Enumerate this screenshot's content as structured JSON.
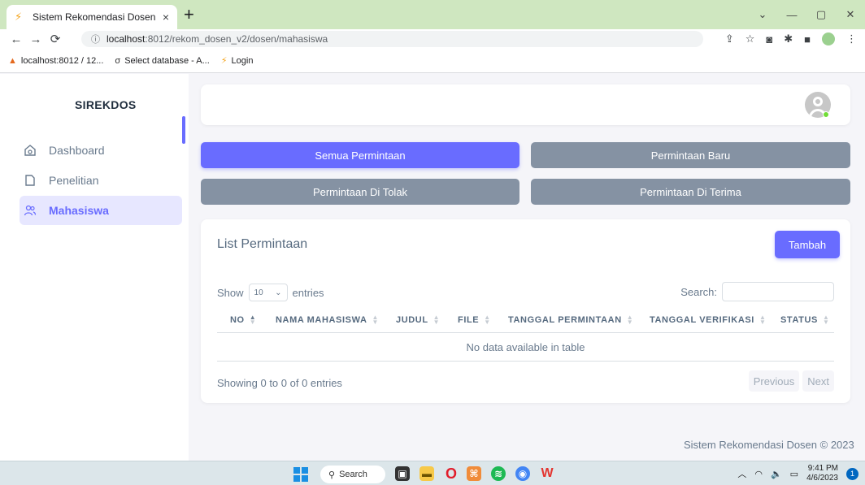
{
  "browser": {
    "tab_title": "Sistem Rekomendasi Dosen",
    "tab_close": "×",
    "new_tab": "+",
    "url_host": "localhost",
    "url_path": ":8012/rekom_dosen_v2/dosen/mahasiswa",
    "bookmarks": [
      {
        "label": "localhost:8012 / 12..."
      },
      {
        "label": "Select database - A..."
      },
      {
        "label": "Login"
      }
    ]
  },
  "sidebar": {
    "brand": "SIREKDOS",
    "items": [
      {
        "label": "Dashboard",
        "icon": "home-icon",
        "active": false
      },
      {
        "label": "Penelitian",
        "icon": "file-icon",
        "active": false
      },
      {
        "label": "Mahasiswa",
        "icon": "users-icon",
        "active": true
      }
    ]
  },
  "filters": {
    "all": "Semua Permintaan",
    "new": "Permintaan Baru",
    "rejected": "Permintaan Di Tolak",
    "accepted": "Permintaan Di Terima"
  },
  "list": {
    "title": "List Permintaan",
    "add_button": "Tambah",
    "show_label": "Show",
    "page_size": "10",
    "entries_label": "entries",
    "search_label": "Search:",
    "columns": [
      "NO",
      "NAMA MAHASISWA",
      "JUDUL",
      "FILE",
      "TANGGAL PERMINTAAN",
      "TANGGAL VERIFIKASI",
      "STATUS"
    ],
    "empty_text": "No data available in table",
    "info": "Showing 0 to 0 of 0 entries",
    "prev": "Previous",
    "next": "Next"
  },
  "footer": "Sistem Rekomendasi Dosen © 2023",
  "taskbar": {
    "search": "Search",
    "time": "9:41 PM",
    "date": "4/6/2023",
    "notifications": "1"
  },
  "colors": {
    "primary": "#696cff",
    "secondary": "#8592a3",
    "browser_frame": "#cfe7c0"
  }
}
